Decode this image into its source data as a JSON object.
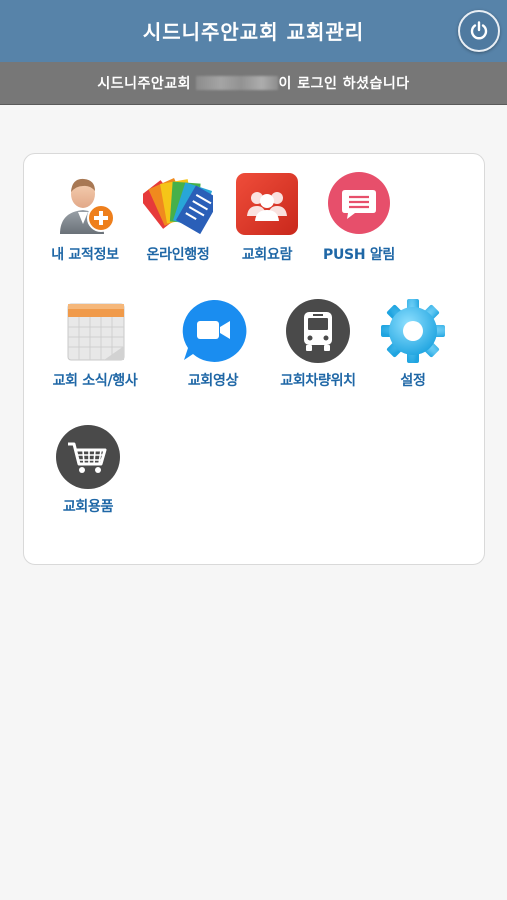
{
  "header": {
    "title": "시드니주안교회 교회관리",
    "power_icon": "power-icon"
  },
  "login_bar": {
    "prefix": "시드니주안교회",
    "suffix": "이 로그인 하셨습니다"
  },
  "menu": [
    {
      "label": "내 교적정보",
      "icon": "user-add-icon"
    },
    {
      "label": "온라인행정",
      "icon": "documents-icon"
    },
    {
      "label": "교회요람",
      "icon": "people-group-icon"
    },
    {
      "label": "PUSH 알림",
      "icon": "message-icon"
    },
    {
      "label": "교회 소식/행사",
      "icon": "calendar-icon"
    },
    {
      "label": "교회영상",
      "icon": "video-camera-icon"
    },
    {
      "label": "교회차량위치",
      "icon": "bus-icon"
    },
    {
      "label": "설정",
      "icon": "gear-icon"
    },
    {
      "label": "교회용품",
      "icon": "shopping-cart-icon"
    }
  ],
  "colors": {
    "header": "#5783a9",
    "login_bar": "#777777",
    "label": "#1f67a6"
  }
}
